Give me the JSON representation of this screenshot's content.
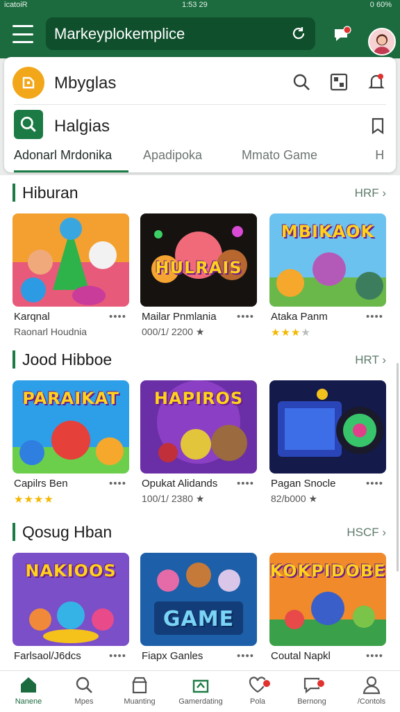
{
  "status_bar": {
    "carrier": "icatoiR",
    "time": "1:53 29",
    "battery": "0 60%"
  },
  "header": {
    "search_value": "Markeyplokemplice"
  },
  "brand_row": {
    "title": "Mbyglas"
  },
  "search_row": {
    "label": "Halgias"
  },
  "tabs": [
    {
      "label": "Adonarl Mrdonika",
      "active": true
    },
    {
      "label": "Apadipoka",
      "active": false
    },
    {
      "label": "Mmato Game",
      "active": false
    },
    {
      "label": "ᕼ",
      "active": false
    }
  ],
  "sections": [
    {
      "title": "Hiburan",
      "more": "HRF ›",
      "cards": [
        {
          "name": "Karqnal",
          "subtitle": "Raonarl Houdnia",
          "stars": null,
          "thumb_text": ""
        },
        {
          "name": "Mailar Pnmlania",
          "subtitle": "000/1/ 2200 ★",
          "stars": null,
          "thumb_text": "HULRAIS"
        },
        {
          "name": "Ataka Panm",
          "subtitle": "",
          "stars": 3,
          "thumb_text": "MBIKAOK"
        }
      ]
    },
    {
      "title": "Jood Hibboe",
      "more": "HRT ›",
      "cards": [
        {
          "name": "Capilrs Ben",
          "subtitle": "",
          "stars": 4,
          "thumb_text": "PARAIKAT"
        },
        {
          "name": "Opukat Alidands",
          "subtitle": "100/1/ 2380 ★",
          "stars": null,
          "thumb_text": "HAPIROS"
        },
        {
          "name": "Pagan Snocle",
          "subtitle": "82/b000 ★",
          "stars": null,
          "thumb_text": ""
        }
      ]
    },
    {
      "title": "Qosug Hban",
      "more": "HSCF ›",
      "cards": [
        {
          "name": "Farlsaol/J6dcs",
          "subtitle": "",
          "stars": null,
          "thumb_text": "NAKIOOS"
        },
        {
          "name": "Fiapx Ganles",
          "subtitle": "",
          "stars": null,
          "thumb_text": "GAME"
        },
        {
          "name": "Coutal Napkl",
          "subtitle": "",
          "stars": null,
          "thumb_text": "KOKPIDOBE"
        }
      ]
    }
  ],
  "bottom_nav": [
    {
      "label": "Nanene",
      "icon": "home-icon",
      "active": true
    },
    {
      "label": "Mpes",
      "icon": "search-icon",
      "active": false
    },
    {
      "label": "Muanting",
      "icon": "store-icon",
      "active": false
    },
    {
      "label": "Gamerdating",
      "icon": "game-icon",
      "active": false
    },
    {
      "label": "Pola",
      "icon": "heart-icon",
      "active": false
    },
    {
      "label": "Bernong",
      "icon": "chat-icon",
      "active": false
    },
    {
      "label": "/Contols",
      "icon": "profile-icon",
      "active": false
    }
  ],
  "colors": {
    "brand": "#1c6b3f",
    "accent": "#1c7a45",
    "star": "#f5b800",
    "badge": "#e0322e"
  }
}
